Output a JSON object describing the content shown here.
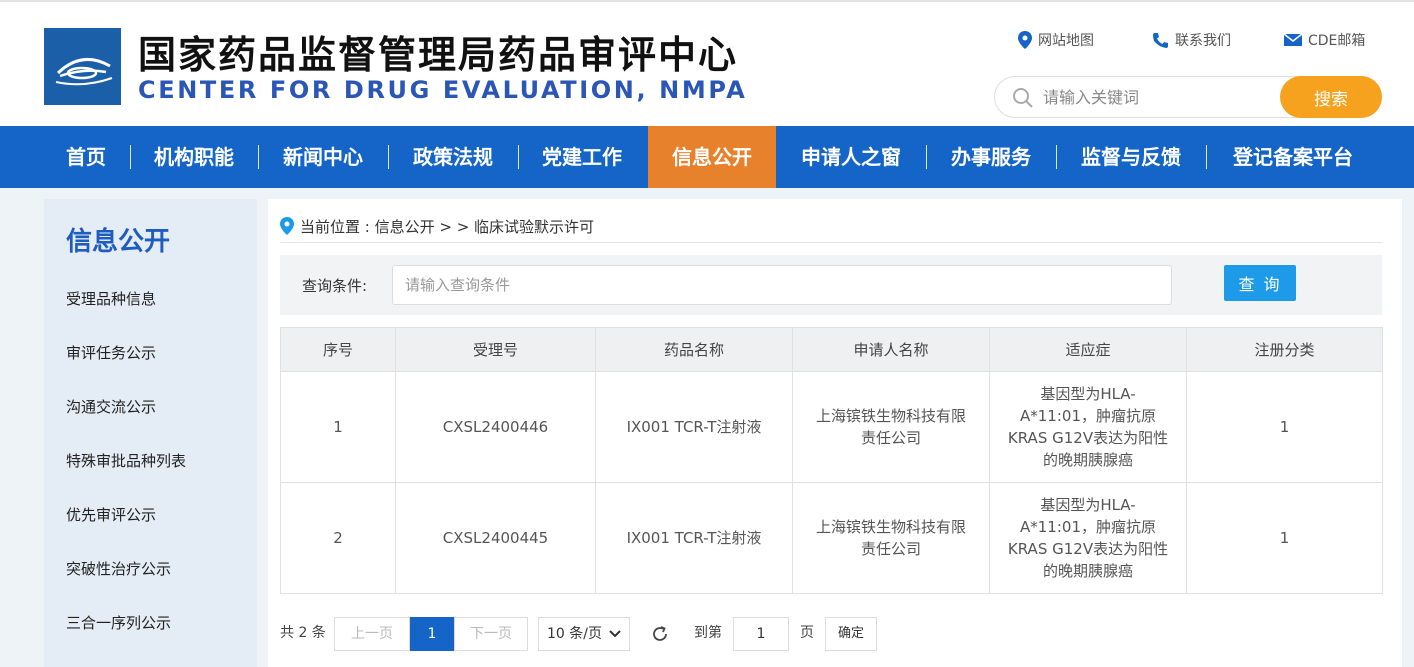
{
  "header": {
    "title": "国家药品监督管理局药品审评中心",
    "subtitle": "CENTER FOR DRUG EVALUATION, NMPA",
    "links": {
      "sitemap": "网站地图",
      "contact": "联系我们",
      "mail": "CDE邮箱"
    },
    "search": {
      "placeholder": "请输入关键词",
      "button": "搜索"
    }
  },
  "nav": {
    "items": [
      "首页",
      "机构职能",
      "新闻中心",
      "政策法规",
      "党建工作",
      "信息公开",
      "申请人之窗",
      "办事服务",
      "监督与反馈",
      "登记备案平台"
    ],
    "active_index": 5
  },
  "sidebar": {
    "title": "信息公开",
    "items": [
      "受理品种信息",
      "审评任务公示",
      "沟通交流公示",
      "特殊审批品种列表",
      "优先审评公示",
      "突破性治疗公示",
      "三合一序列公示"
    ]
  },
  "breadcrumb": "当前位置 : 信息公开 > > 临床试验默示许可",
  "query": {
    "label": "查询条件:",
    "placeholder": "请输入查询条件",
    "button": "查 询"
  },
  "table": {
    "headers": [
      "序号",
      "受理号",
      "药品名称",
      "申请人名称",
      "适应症",
      "注册分类"
    ],
    "rows": [
      [
        "1",
        "CXSL2400446",
        "IX001 TCR-T注射液",
        "上海镔铁生物科技有限责任公司",
        "基因型为HLA-A*11:01，肿瘤抗原KRAS G12V表达为阳性的晚期胰腺癌",
        "1"
      ],
      [
        "2",
        "CXSL2400445",
        "IX001 TCR-T注射液",
        "上海镔铁生物科技有限责任公司",
        "基因型为HLA-A*11:01，肿瘤抗原KRAS G12V表达为阳性的晚期胰腺癌",
        "1"
      ]
    ]
  },
  "pagination": {
    "total": "共 2 条",
    "prev": "上一页",
    "current": "1",
    "next": "下一页",
    "page_size": "10 条/页",
    "goto_label": "到第",
    "goto_value": "1",
    "page_suffix": "页",
    "confirm": "确定"
  },
  "colors": {
    "nav_bg": "#1565c8",
    "nav_active": "#e8812c",
    "search_button": "#f6a21e",
    "query_button": "#1e9be8",
    "sidebar_title": "#1f5cbf"
  }
}
